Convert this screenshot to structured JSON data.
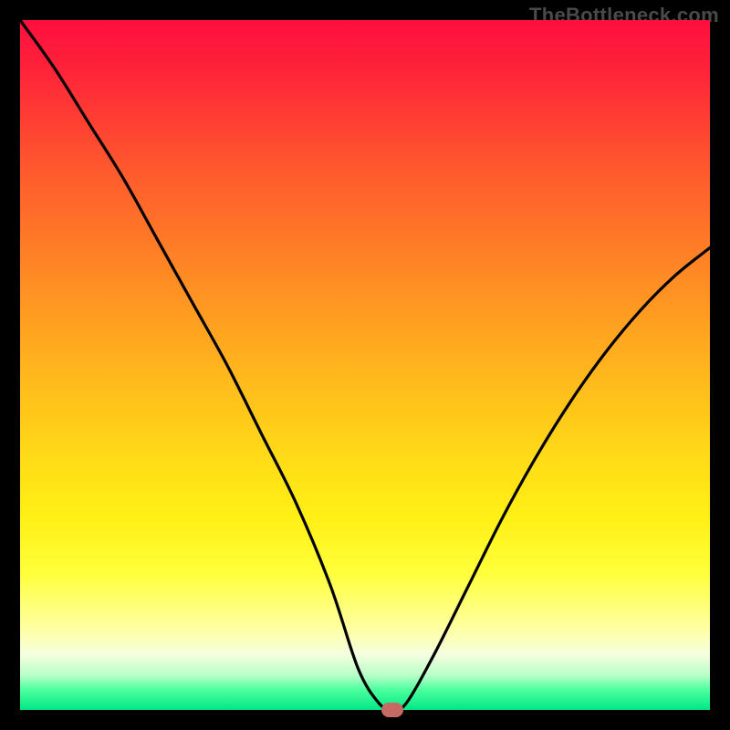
{
  "attribution": "TheBottleneck.com",
  "chart_data": {
    "type": "line",
    "title": "",
    "xlabel": "",
    "ylabel": "",
    "xlim": [
      0,
      100
    ],
    "ylim": [
      0,
      100
    ],
    "x": [
      0,
      5,
      10,
      15,
      20,
      25,
      30,
      35,
      40,
      45,
      49,
      52,
      54,
      56,
      60,
      65,
      70,
      75,
      80,
      85,
      90,
      95,
      100
    ],
    "values": [
      100,
      93,
      85,
      77,
      68,
      59,
      50,
      40,
      30,
      18,
      6,
      1,
      0,
      1,
      8,
      18,
      28,
      37,
      45,
      52,
      58,
      63,
      67
    ],
    "marker": {
      "x": 54,
      "y": 0
    },
    "colors": {
      "top": "#ff0f3f",
      "mid": "#ffe81a",
      "bottom": "#00e884",
      "curve": "#000000",
      "marker": "#c66b63"
    }
  }
}
